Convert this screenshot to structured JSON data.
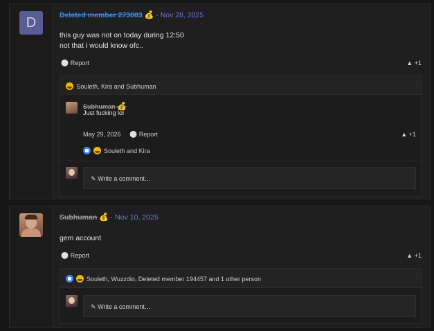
{
  "posts": [
    {
      "author": "Deleted member 273003",
      "date": "Nov 28, 2025",
      "content_lines": [
        "this guy was not on today during 12:50",
        "not that i would know ofc.."
      ],
      "avatar_letter": "D",
      "report_label": "Report",
      "like_label": "+1",
      "reactions_text": "Souleth, Kira and Subhuman",
      "comment": {
        "author": "Subhuman",
        "text": "Just fucking lol",
        "date": "May 29, 2026",
        "report_label": "Report",
        "like_label": "+1",
        "reactions_text": "Souleth and Kira"
      },
      "write_placeholder": "Write a comment…"
    },
    {
      "author": "Subhuman",
      "date": "Nov 10, 2025",
      "content_lines": [
        "gem account"
      ],
      "report_label": "Report",
      "like_label": "+1",
      "reactions_text": "Souleth, Wuzzdio, Deleted member 194457 and 1 other person",
      "write_placeholder": "Write a comment…"
    }
  ],
  "icons": {
    "separator": "·",
    "pencil": "✎",
    "bell": "🔔",
    "thumb": "👍",
    "money_bag": "💰"
  },
  "colors": {
    "deleted_username": "#3d8cf5",
    "date_link": "#6d77d8",
    "background": "#161616"
  }
}
